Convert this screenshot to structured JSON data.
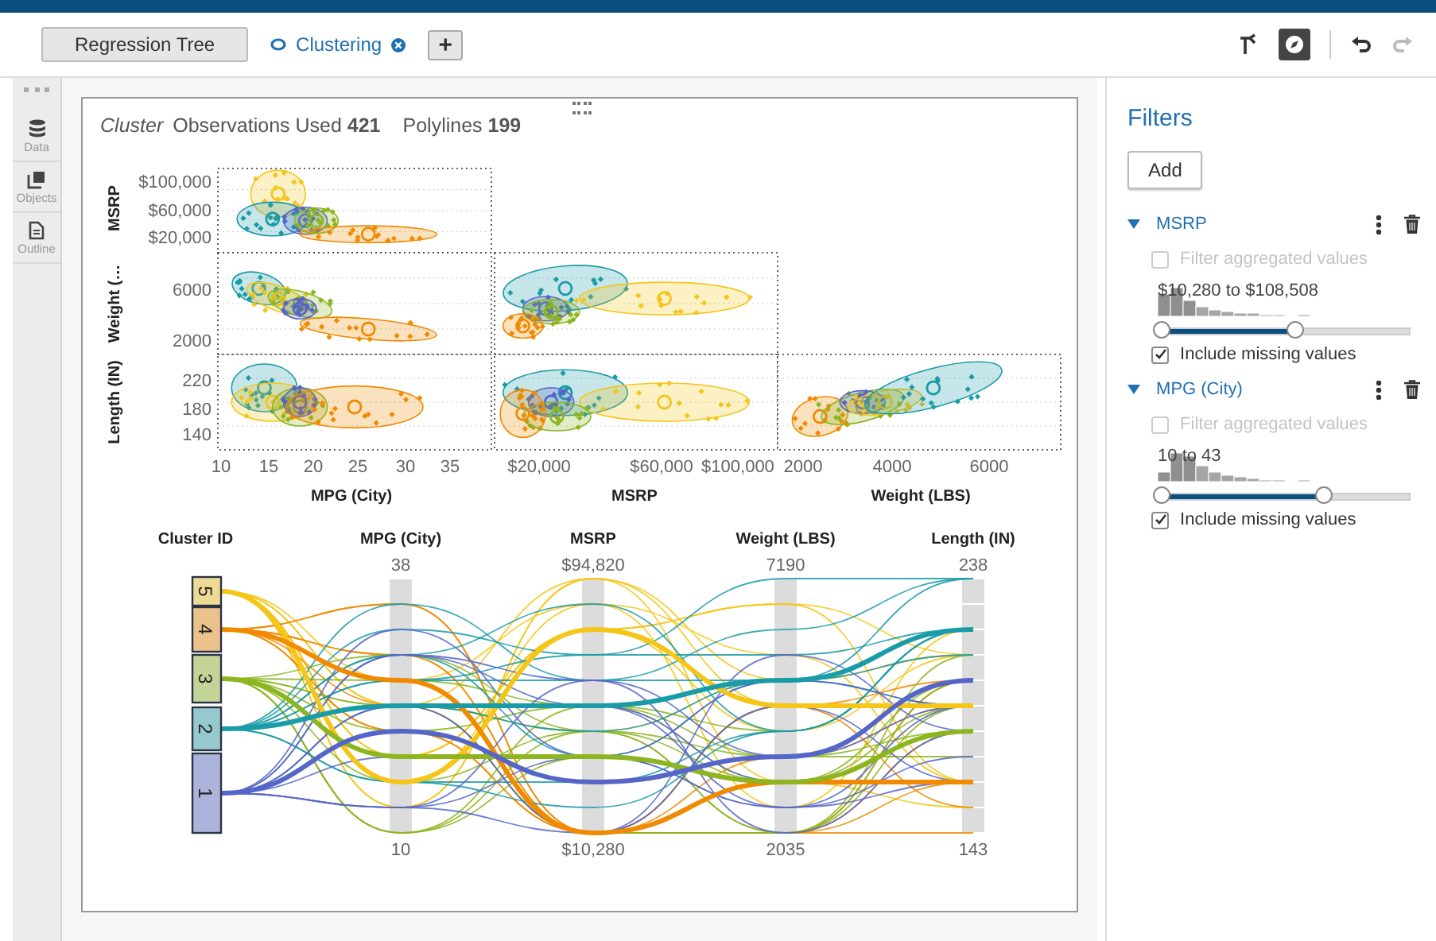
{
  "tabs": [
    {
      "label": "Regression Tree",
      "selected": false
    },
    {
      "label": "Clustering",
      "selected": true
    }
  ],
  "add_tab": "+",
  "toolbar": [
    {
      "kind": "branch",
      "disabled": false
    },
    {
      "kind": "compass",
      "disabled": false
    },
    {
      "kind": "undo",
      "disabled": false
    },
    {
      "kind": "redo",
      "disabled": true
    }
  ],
  "sidebar": {
    "items": [
      {
        "label": "Data",
        "kind": "data"
      },
      {
        "label": "Objects",
        "kind": "objects"
      },
      {
        "label": "Outline",
        "kind": "outline"
      }
    ]
  },
  "report": {
    "title": "Cluster",
    "stats": [
      "Observations Used **421**",
      "Polylines **199**"
    ],
    "scatter_matrix": {
      "row_titles": [
        "MSRP",
        "Weight (…",
        "Length (IN)"
      ],
      "rows": [
        {
          "yticks": [
            "$100,000",
            "$60,000",
            "$20,000"
          ]
        },
        {
          "yticks": [
            "6000",
            "2000"
          ]
        },
        {
          "yticks": [
            "220",
            "180",
            "140"
          ]
        }
      ],
      "columns": [
        {
          "title": "MPG (City)",
          "xticks": [
            "10",
            "15",
            "20",
            "25",
            "30",
            "35"
          ]
        },
        {
          "title": "MSRP",
          "xticks": [
            "$20,000",
            "$60,000",
            "$100,000"
          ]
        },
        {
          "title": "Weight (LBS)",
          "xticks": [
            "2000",
            "4000",
            "6000"
          ]
        }
      ]
    },
    "parallel": {
      "first_axis": "Cluster ID",
      "axes": [
        {
          "title": "MPG (City)",
          "max": "38",
          "min": "10"
        },
        {
          "title": "MSRP",
          "max": "$94,820",
          "min": "$10,280"
        },
        {
          "title": "Weight (LBS)",
          "max": "7190",
          "min": "2035"
        },
        {
          "title": "Length (IN)",
          "max": "238",
          "min": "143"
        }
      ],
      "clusters": [
        {
          "label": "5",
          "color": "#f5c518"
        },
        {
          "label": "4",
          "color": "#f08a00"
        },
        {
          "label": "3",
          "color": "#8db520"
        },
        {
          "label": "2",
          "color": "#1a9ba8"
        },
        {
          "label": "1",
          "color": "#5566c8"
        }
      ]
    }
  },
  "filters": {
    "title": "Filters",
    "add": "Add",
    "items": [
      {
        "name": "MSRP",
        "expanded": true,
        "aggregated": {
          "label": "Filter aggregated values",
          "checked": false,
          "disabled": true
        },
        "range_label": "$10,280 to $108,508",
        "thumbs": [
          {
            "level": 0
          },
          {
            "level": 0.54
          }
        ],
        "missing": {
          "label": "Include missing values",
          "checked": true
        }
      },
      {
        "name": "MPG (City)",
        "expanded": true,
        "aggregated": {
          "label": "Filter aggregated values",
          "checked": false,
          "disabled": true
        },
        "range_label": "10 to 43",
        "thumbs": [
          {
            "level": 0
          },
          {
            "level": 0.66
          }
        ],
        "missing": {
          "label": "Include missing values",
          "checked": true
        }
      }
    ]
  }
}
